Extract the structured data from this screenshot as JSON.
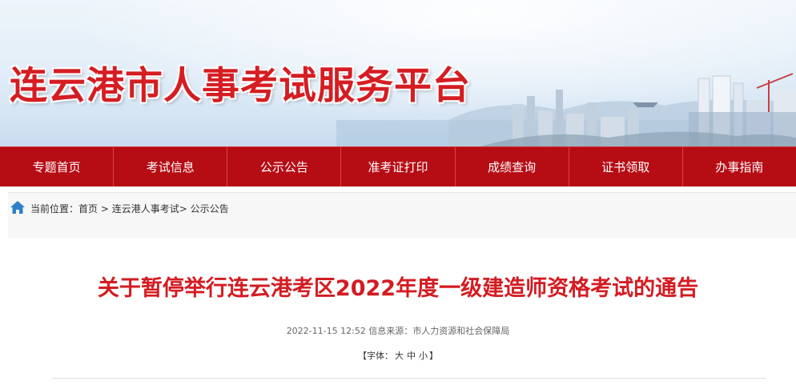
{
  "header": {
    "site_title": "连云港市人事考试服务平台"
  },
  "nav": {
    "items": [
      {
        "label": "专题首页"
      },
      {
        "label": "考试信息"
      },
      {
        "label": "公示公告"
      },
      {
        "label": "准考证打印"
      },
      {
        "label": "成绩查询"
      },
      {
        "label": "证书领取"
      },
      {
        "label": "办事指南"
      }
    ]
  },
  "breadcrumb": {
    "prefix": "当前位置：",
    "home": "首页",
    "sep1": " > ",
    "section": "连云港人事考试",
    "sep2": "> ",
    "current": "公示公告"
  },
  "article": {
    "title": "关于暂停举行连云港考区2022年度一级建造师资格考试的通告",
    "datetime": "2022-11-15 12:52",
    "source_label": "信息来源：",
    "source": "市人力资源和社会保障局",
    "font_open": "【字体：",
    "font_large": "大",
    "font_medium": "中",
    "font_small": "小",
    "font_close": "】"
  },
  "colors": {
    "brand_red": "#b60d15",
    "title_red": "#d31c22"
  }
}
